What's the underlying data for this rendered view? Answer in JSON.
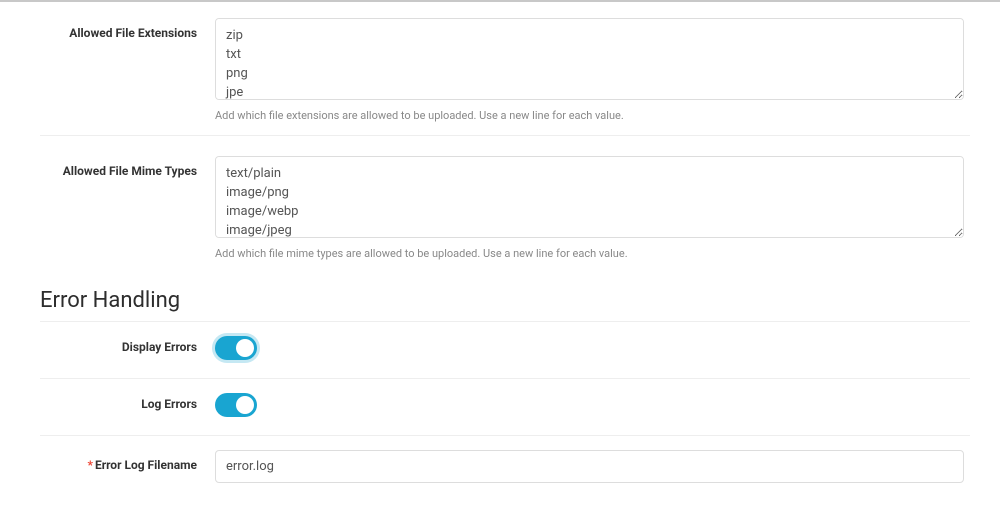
{
  "fields": {
    "allowed_extensions": {
      "label": "Allowed File Extensions",
      "value": "zip\ntxt\npng\njpe\njpeg\nwebp",
      "help": "Add which file extensions are allowed to be uploaded. Use a new line for each value."
    },
    "allowed_mime_types": {
      "label": "Allowed File Mime Types",
      "value": "text/plain\nimage/png\nimage/webp\nimage/jpeg\nimage/gif\nimage/bmp",
      "help": "Add which file mime types are allowed to be uploaded. Use a new line for each value."
    }
  },
  "section": {
    "error_handling": "Error Handling"
  },
  "toggles": {
    "display_errors": {
      "label": "Display Errors",
      "on": true
    },
    "log_errors": {
      "label": "Log Errors",
      "on": true
    }
  },
  "error_log": {
    "label": "Error Log Filename",
    "value": "error.log"
  }
}
